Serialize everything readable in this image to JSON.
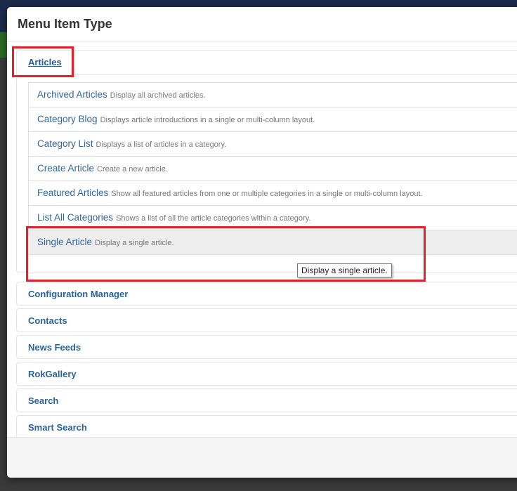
{
  "modal": {
    "title": "Menu Item Type"
  },
  "articles": {
    "heading": "Articles",
    "items": [
      {
        "title": "Archived Articles",
        "description": "Display all archived articles."
      },
      {
        "title": "Category Blog",
        "description": "Displays article introductions in a single or multi-column layout."
      },
      {
        "title": "Category List",
        "description": "Displays a list of articles in a category."
      },
      {
        "title": "Create Article",
        "description": "Create a new article."
      },
      {
        "title": "Featured Articles",
        "description": "Show all featured articles from one or multiple categories in a single or multi-column layout."
      },
      {
        "title": "List All Categories",
        "description": "Shows a list of all the article categories within a category."
      },
      {
        "title": "Single Article",
        "description": "Display a single article."
      }
    ]
  },
  "groups": [
    "Configuration Manager",
    "Contacts",
    "News Feeds",
    "RokGallery",
    "Search",
    "Smart Search"
  ],
  "tooltip": {
    "text": "Display a single article."
  },
  "colors": {
    "link": "#336699",
    "highlight": "#e0222a",
    "hover_row": "#eeeeee"
  }
}
